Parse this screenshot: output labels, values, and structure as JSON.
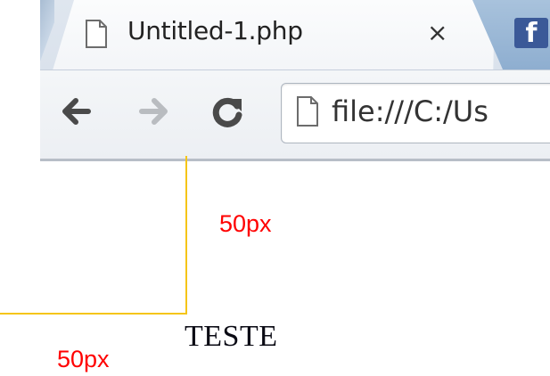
{
  "browser": {
    "tab": {
      "title": "Untitled-1.php",
      "close_label": "×",
      "icon": "file-icon"
    },
    "tab2": {
      "icon": "facebook-icon",
      "glyph": "f"
    },
    "toolbar": {
      "back_icon": "arrow-left-icon",
      "forward_icon": "arrow-right-icon",
      "reload_icon": "reload-icon",
      "address": "file:///C:/Us"
    }
  },
  "annotations": {
    "top_offset_label": "50px",
    "left_offset_label": "50px",
    "guide_color": "#f5c518",
    "label_color": "#ff0000"
  },
  "content": {
    "text": "TESTE"
  }
}
